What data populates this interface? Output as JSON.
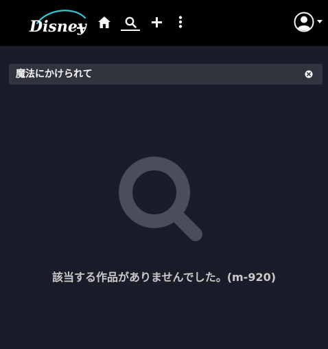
{
  "header": {
    "logo_alt": "Disney+",
    "nav": [
      {
        "name": "home",
        "icon": "home-icon"
      },
      {
        "name": "search",
        "icon": "search-icon",
        "active": true
      },
      {
        "name": "watchlist-add",
        "icon": "plus-icon"
      },
      {
        "name": "more",
        "icon": "more-vertical-icon"
      }
    ],
    "profile_icon": "avatar-icon"
  },
  "search": {
    "value": "魔法にかけられて",
    "clear_icon": "close-circle-icon"
  },
  "empty_state": {
    "icon": "magnifier-icon",
    "message": "該当する作品がありませんでした。(m-920)"
  },
  "colors": {
    "background": "#1a1c29",
    "topbar": "#000000",
    "search_bar": "#31343e",
    "text": "#f9f9f9",
    "muted_text": "#cacaca",
    "empty_icon": "#4b4e5a",
    "logo_arc": "#33c7d6"
  }
}
